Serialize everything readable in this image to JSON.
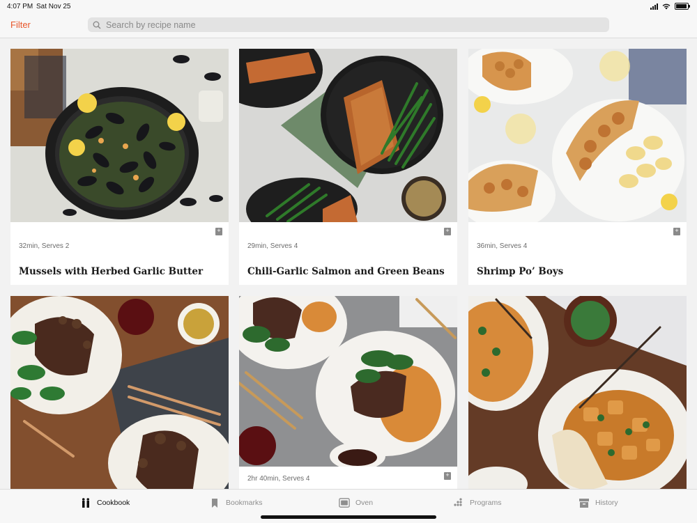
{
  "status": {
    "time": "4:07 PM",
    "date": "Sat Nov 25"
  },
  "header": {
    "filter_label": "Filter",
    "search_placeholder": "Search by recipe name"
  },
  "recipes": [
    {
      "meta": "32min, Serves 2",
      "title": "Mussels with Herbed Garlic Butter"
    },
    {
      "meta": "29min, Serves 4",
      "title": "Chili-Garlic Salmon and Green Beans"
    },
    {
      "meta": "36min, Serves 4",
      "title": "Shrimp Po’ Boys"
    },
    {
      "meta": "",
      "title": ""
    },
    {
      "meta": "2hr 40min, Serves 4",
      "title": ""
    },
    {
      "meta": "",
      "title": ""
    }
  ],
  "tabs": [
    {
      "label": "Cookbook",
      "icon": "cookbook-icon"
    },
    {
      "label": "Bookmarks",
      "icon": "bookmark-icon"
    },
    {
      "label": "Oven",
      "icon": "oven-icon"
    },
    {
      "label": "Programs",
      "icon": "programs-icon"
    },
    {
      "label": "History",
      "icon": "history-icon"
    }
  ],
  "colors": {
    "accent": "#e8562a",
    "tab_active": "#111111",
    "tab_inactive": "#8e8e8e"
  }
}
